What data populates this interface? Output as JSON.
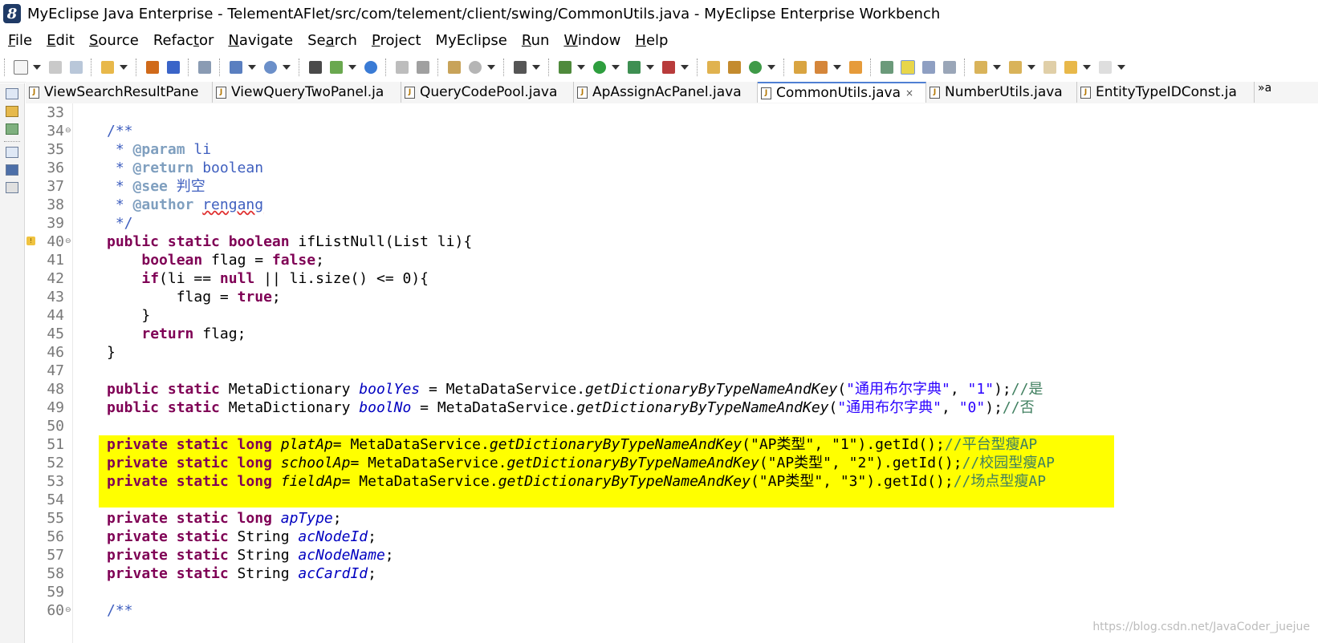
{
  "window": {
    "title": "MyEclipse Java Enterprise - TelementAFlet/src/com/telement/client/swing/CommonUtils.java - MyEclipse Enterprise Workbench",
    "app_icon": "myeclipse-logo-icon"
  },
  "menu": [
    {
      "mnemonic": "F",
      "rest": "ile"
    },
    {
      "mnemonic": "E",
      "rest": "dit"
    },
    {
      "mnemonic": "S",
      "rest": "ource"
    },
    {
      "pre": "Refac",
      "mnemonic": "t",
      "rest": "or"
    },
    {
      "mnemonic": "N",
      "rest": "avigate"
    },
    {
      "pre": "Se",
      "mnemonic": "a",
      "rest": "rch"
    },
    {
      "mnemonic": "P",
      "rest": "roject"
    },
    {
      "pre": "MyEclipse",
      "mnemonic": "",
      "rest": ""
    },
    {
      "mnemonic": "R",
      "rest": "un"
    },
    {
      "mnemonic": "W",
      "rest": "indow"
    },
    {
      "mnemonic": "H",
      "rest": "elp"
    }
  ],
  "tabs": [
    {
      "label": "ViewSearchResultPane",
      "active": false
    },
    {
      "label": "ViewQueryTwoPanel.ja",
      "active": false
    },
    {
      "label": "QueryCodePool.java",
      "active": false
    },
    {
      "label": "ApAssignAcPanel.java",
      "active": false
    },
    {
      "label": "CommonUtils.java",
      "active": true,
      "close": "×"
    },
    {
      "label": "NumberUtils.java",
      "active": false
    },
    {
      "label": "EntityTypeIDConst.ja",
      "active": false
    }
  ],
  "tab_overflow": "»a",
  "editor": {
    "lines": [
      {
        "n": "33"
      },
      {
        "n": "34",
        "fold": "⊖"
      },
      {
        "n": "35"
      },
      {
        "n": "36"
      },
      {
        "n": "37"
      },
      {
        "n": "38"
      },
      {
        "n": "39"
      },
      {
        "n": "40",
        "fold": "⊖",
        "warn": "!"
      },
      {
        "n": "41"
      },
      {
        "n": "42"
      },
      {
        "n": "43"
      },
      {
        "n": "44"
      },
      {
        "n": "45"
      },
      {
        "n": "46"
      },
      {
        "n": "47"
      },
      {
        "n": "48"
      },
      {
        "n": "49"
      },
      {
        "n": "50"
      },
      {
        "n": "51"
      },
      {
        "n": "52"
      },
      {
        "n": "53"
      },
      {
        "n": "54"
      },
      {
        "n": "55"
      },
      {
        "n": "56"
      },
      {
        "n": "57"
      },
      {
        "n": "58"
      },
      {
        "n": "59"
      },
      {
        "n": "60",
        "fold": "⊖"
      }
    ],
    "tokens": {
      "l34": "/**",
      "l35a": " * ",
      "l35b": "@param",
      "l35c": " li",
      "l36a": " * ",
      "l36b": "@return",
      "l36c": " boolean",
      "l37a": " * ",
      "l37b": "@see",
      "l37c": " 判空",
      "l38a": " * ",
      "l38b": "@author",
      "l38c": " ",
      "l38d": "rengang",
      "l39": " */",
      "l40a": "public static boolean",
      "l40b": " ifListNull(List li){",
      "l41a": "    ",
      "l41b": "boolean",
      "l41c": " flag = ",
      "l41d": "false",
      "l41e": ";",
      "l42a": "    ",
      "l42b": "if",
      "l42c": "(li == ",
      "l42d": "null",
      "l42e": " || li.size() <= 0){",
      "l43a": "        flag = ",
      "l43b": "true",
      "l43c": ";",
      "l44": "    }",
      "l45a": "    ",
      "l45b": "return",
      "l45c": " flag;",
      "l46": "}",
      "l48a": "public static",
      "l48b": " MetaDictionary ",
      "l48c": "boolYes",
      "l48d": " = MetaDataService.",
      "l48e": "getDictionaryByTypeNameAndKey",
      "l48f": "(",
      "l48g": "\"通用布尔字典\"",
      "l48h": ", ",
      "l48i": "\"1\"",
      "l48j": ");",
      "l48k": "//是",
      "l49a": "public static",
      "l49b": " MetaDictionary ",
      "l49c": "boolNo",
      "l49d": " = MetaDataService.",
      "l49e": "getDictionaryByTypeNameAndKey",
      "l49f": "(",
      "l49g": "\"通用布尔字典\"",
      "l49h": ", ",
      "l49i": "\"0\"",
      "l49j": ");",
      "l49k": "//否",
      "l51a": "private static long",
      "l51b": " ",
      "l51c": "platAp",
      "l51d": "= MetaDataService.",
      "l51e": "getDictionaryByTypeNameAndKey",
      "l51f": "(\"AP类型\", \"1\").getId();",
      "l51g": "//平台型瘦AP",
      "l52a": "private static long",
      "l52b": " ",
      "l52c": "schoolAp",
      "l52d": "= MetaDataService.",
      "l52e": "getDictionaryByTypeNameAndKey",
      "l52f": "(\"AP类型\", \"2\").getId();",
      "l52g": "//校园型瘦AP",
      "l53a": "private static long",
      "l53b": " ",
      "l53c": "fieldAp",
      "l53d": "= MetaDataService.",
      "l53e": "getDictionaryByTypeNameAndKey",
      "l53f": "(\"AP类型\", \"3\").getId();",
      "l53g": "//场点型瘦AP",
      "l55a": "private static long",
      "l55b": " ",
      "l55c": "apType",
      "l55d": ";",
      "l56a": "private static",
      "l56b": " String ",
      "l56c": "acNodeId",
      "l56d": ";",
      "l57a": "private static",
      "l57b": " String ",
      "l57c": "acNodeName",
      "l57d": ";",
      "l58a": "private static",
      "l58b": " String ",
      "l58c": "acCardId",
      "l58d": ";",
      "l60": "/**"
    }
  },
  "watermark": "https://blog.csdn.net/JavaCoder_juejue",
  "colors": {
    "keyword": "#7f0055",
    "javadoc": "#3f5fbf",
    "line_comment": "#3f7f5f",
    "string": "#2a00ff",
    "field": "#0000c0",
    "highlight": "#ffff00"
  }
}
